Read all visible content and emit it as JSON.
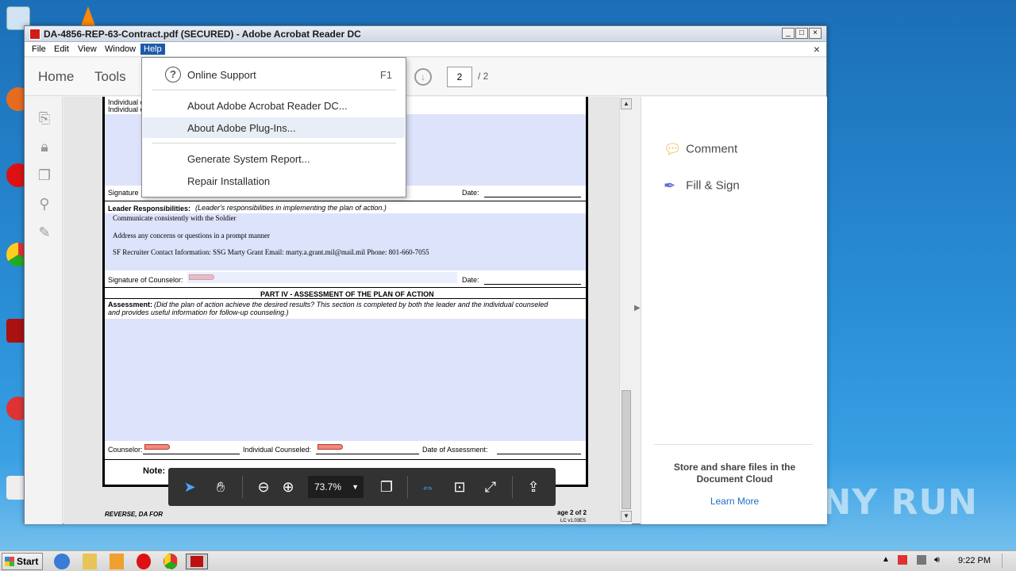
{
  "window": {
    "title": "DA-4856-REP-63-Contract.pdf (SECURED) - Adobe Acrobat Reader DC",
    "minimize": "_",
    "maximize": "□",
    "close": "×"
  },
  "menu": {
    "items": [
      "File",
      "Edit",
      "View",
      "Window",
      "Help"
    ],
    "doc_close": "×"
  },
  "toolbar": {
    "tabs": [
      "Home",
      "Tools"
    ],
    "current_page": "2",
    "page_total": "/ 2"
  },
  "help_menu": {
    "items": [
      {
        "label": "Online Support",
        "shortcut": "F1"
      },
      {
        "label": "About Adobe Acrobat Reader DC..."
      },
      {
        "label": "About Adobe Plug-Ins..."
      },
      {
        "label": "Generate System Report..."
      },
      {
        "label": "Repair Installation"
      }
    ]
  },
  "document": {
    "top_labels": [
      "Individual c",
      "Individual c"
    ],
    "signature_label": "Signature",
    "date_label": "Date:",
    "leader_heading": "Leader Responsibilities:",
    "leader_subtitle": "(Leader's responsibilities in implementing the plan of action.)",
    "leader_items": [
      "Communicate consistently with the Soldier",
      "Address any concerns or questions in a prompt manner",
      "SF Recruiter Contact Information:  SSG Marty Grant    Email: marty.a.grant.mil@mail.mil    Phone: 801-660-7055"
    ],
    "signature_counselor": "Signature of Counselor:",
    "date_label_2": "Date:",
    "part4_heading": "PART IV - ASSESSMENT OF THE PLAN OF ACTION",
    "assessment_label": "Assessment:",
    "assessment_text_1": "(Did the plan of action achieve the desired results?  This section is completed by both the leader and the individual counseled",
    "assessment_text_2": "and provides useful information for follow-up counseling.)",
    "counselor_label": "Counselor:",
    "individual_label": "Individual Counseled:",
    "date_assessment": "Date of Assessment:",
    "note_label": "Note:",
    "footer_left": "REVERSE, DA FOR",
    "footer_right": "age 2 of 2",
    "footer_right_2": "LC v1.03ES"
  },
  "right_pane": {
    "tools": [
      {
        "label": "Comment",
        "icon": "comment-icon"
      },
      {
        "label": "Fill & Sign",
        "icon": "pen-icon"
      }
    ],
    "cloud_text": "Store and share files in the Document Cloud",
    "cloud_link": "Learn More"
  },
  "floating_toolbar": {
    "zoom": "73.7%"
  },
  "taskbar": {
    "start": "Start",
    "clock": "9:22 PM"
  },
  "watermark": "ANY  RUN",
  "colors": {
    "form_fill": "#dde3fb",
    "menu_active": "#1e5aa8",
    "link": "#1c6fc4",
    "desktop": "#2a8fd6"
  }
}
